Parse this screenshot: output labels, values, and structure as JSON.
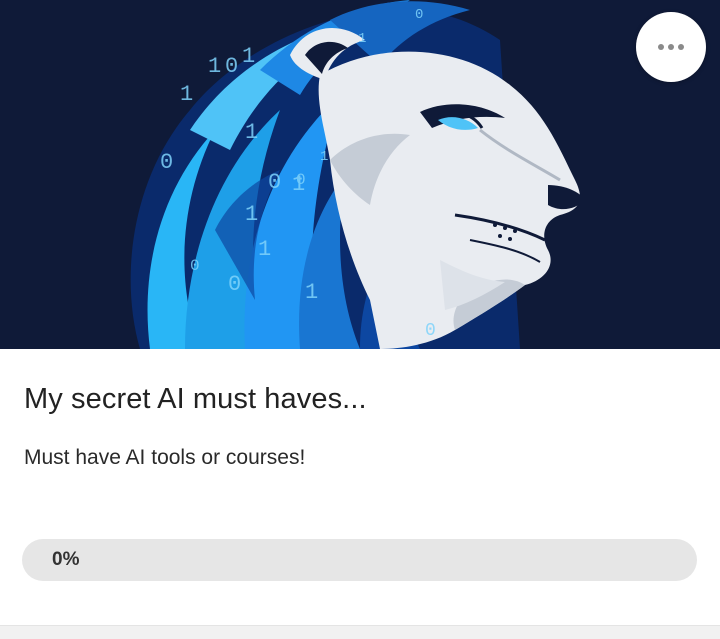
{
  "card": {
    "title": "My secret AI must haves...",
    "subtitle": "Must have AI tools or courses!",
    "progress": {
      "label": "0%",
      "value": 0
    },
    "image": {
      "binary_digits": [
        "1",
        "0",
        "1",
        "1",
        "1",
        "0",
        "1",
        "0",
        "1",
        "0",
        "1",
        "1",
        "0",
        "1",
        "0",
        "0",
        "1",
        "0"
      ]
    }
  },
  "menu_button": {
    "icon": "more-horizontal-icon"
  },
  "colors": {
    "hero_background": "#0f1a38",
    "mane_light": "#29b6f6",
    "mane_mid": "#1e88e5",
    "mane_dark": "#0d47a1",
    "lion_face": "#e9ecf1",
    "eye": "#4fc3f7",
    "progress_track": "#e6e6e6"
  }
}
